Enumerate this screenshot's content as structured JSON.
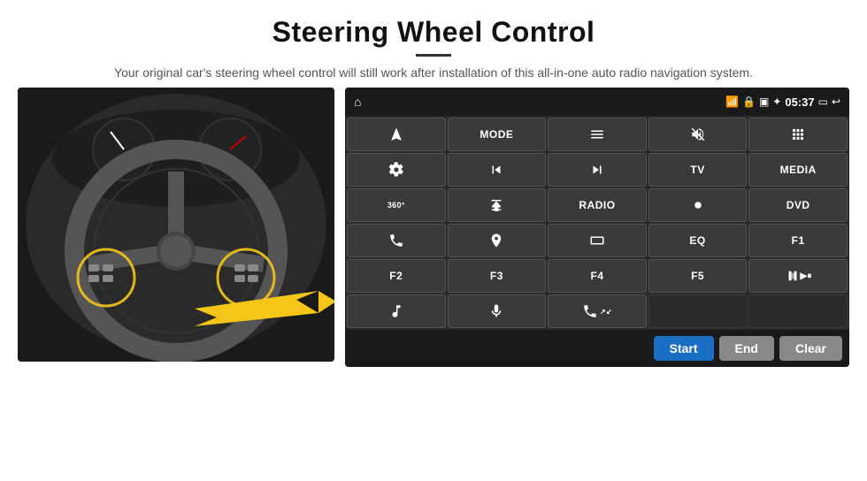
{
  "header": {
    "title": "Steering Wheel Control",
    "subtitle": "Your original car's steering wheel control will still work after installation of this all-in-one auto radio navigation system."
  },
  "status_bar": {
    "time": "05:37"
  },
  "grid_buttons": [
    {
      "id": "b1",
      "type": "icon",
      "icon": "navigate",
      "label": ""
    },
    {
      "id": "b2",
      "type": "text",
      "label": "MODE"
    },
    {
      "id": "b3",
      "type": "icon",
      "icon": "list",
      "label": ""
    },
    {
      "id": "b4",
      "type": "icon",
      "icon": "mute",
      "label": ""
    },
    {
      "id": "b5",
      "type": "icon",
      "icon": "grid-app",
      "label": ""
    },
    {
      "id": "b6",
      "type": "icon",
      "icon": "settings",
      "label": ""
    },
    {
      "id": "b7",
      "type": "icon",
      "icon": "prev",
      "label": ""
    },
    {
      "id": "b8",
      "type": "icon",
      "icon": "next",
      "label": ""
    },
    {
      "id": "b9",
      "type": "text",
      "label": "TV"
    },
    {
      "id": "b10",
      "type": "text",
      "label": "MEDIA"
    },
    {
      "id": "b11",
      "type": "icon",
      "icon": "360-car",
      "label": ""
    },
    {
      "id": "b12",
      "type": "icon",
      "icon": "eject",
      "label": ""
    },
    {
      "id": "b13",
      "type": "text",
      "label": "RADIO"
    },
    {
      "id": "b14",
      "type": "icon",
      "icon": "brightness",
      "label": ""
    },
    {
      "id": "b15",
      "type": "text",
      "label": "DVD"
    },
    {
      "id": "b16",
      "type": "icon",
      "icon": "phone",
      "label": ""
    },
    {
      "id": "b17",
      "type": "icon",
      "icon": "gps",
      "label": ""
    },
    {
      "id": "b18",
      "type": "icon",
      "icon": "rectangle",
      "label": ""
    },
    {
      "id": "b19",
      "type": "text",
      "label": "EQ"
    },
    {
      "id": "b20",
      "type": "text",
      "label": "F1"
    },
    {
      "id": "b21",
      "type": "text",
      "label": "F2"
    },
    {
      "id": "b22",
      "type": "text",
      "label": "F3"
    },
    {
      "id": "b23",
      "type": "text",
      "label": "F4"
    },
    {
      "id": "b24",
      "type": "text",
      "label": "F5"
    },
    {
      "id": "b25",
      "type": "icon",
      "icon": "play-pause",
      "label": ""
    },
    {
      "id": "b26",
      "type": "icon",
      "icon": "music",
      "label": ""
    },
    {
      "id": "b27",
      "type": "icon",
      "icon": "mic",
      "label": ""
    },
    {
      "id": "b28",
      "type": "icon",
      "icon": "answer-call",
      "label": ""
    },
    {
      "id": "b29",
      "type": "empty",
      "label": ""
    },
    {
      "id": "b30",
      "type": "empty",
      "label": ""
    }
  ],
  "bottom_bar": {
    "start_label": "Start",
    "end_label": "End",
    "clear_label": "Clear"
  }
}
